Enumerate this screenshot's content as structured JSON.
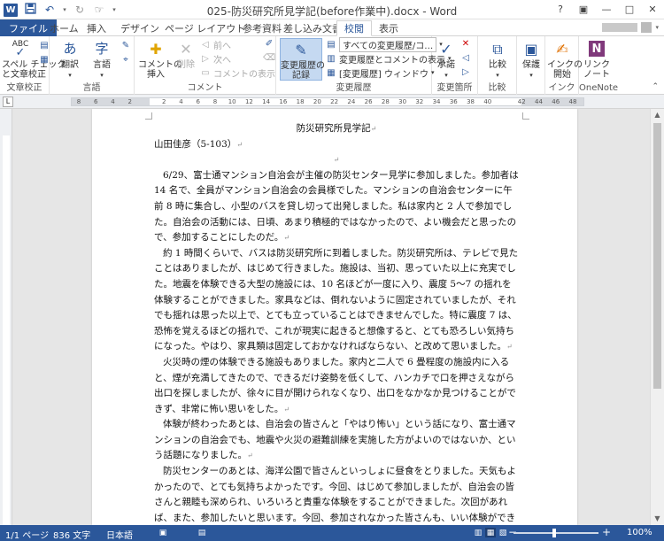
{
  "window": {
    "title": "025-防災研究所見学記(before作業中).docx - Word",
    "app_logo": "W",
    "qat_icons": [
      "save-icon",
      "undo-icon",
      "redo-icon",
      "touch-mode-icon"
    ],
    "controls": [
      "?",
      "▣",
      "—",
      "□",
      "✕"
    ]
  },
  "tabs": [
    {
      "label": "ファイル"
    },
    {
      "label": "ホーム"
    },
    {
      "label": "挿入"
    },
    {
      "label": "デザイン"
    },
    {
      "label": "ページ レイアウト"
    },
    {
      "label": "参考資料"
    },
    {
      "label": "差し込み文書"
    },
    {
      "label": "校閲"
    },
    {
      "label": "表示"
    }
  ],
  "active_tab": "校閲",
  "ribbon": {
    "proofing": {
      "group_label": "文章校正",
      "spell_label": "スペル チェック\nと文章校正",
      "spell_top": "ABC"
    },
    "language": {
      "group_label": "言語",
      "translate_label": "翻訳",
      "language_label": "言語"
    },
    "comments": {
      "group_label": "コメント",
      "new_comment": "コメントの\n挿入",
      "delete": "削除",
      "prev": "前へ",
      "next": "次へ",
      "show_comments": "コメントの表示"
    },
    "tracking": {
      "group_label": "変更履歴",
      "track_changes": "変更履歴の\n記録",
      "display_dropdown": "すべての変更履歴/コ…",
      "show_markup": "変更履歴とコメントの表示",
      "reviewing_pane": "[変更履歴] ウィンドウ"
    },
    "changes": {
      "group_label": "変更箇所",
      "accept": "承諾"
    },
    "compare": {
      "group_label": "比較",
      "compare": "比較"
    },
    "protect": {
      "group_label": "",
      "protect": "保護"
    },
    "ink": {
      "group_label": "インク",
      "start_inking": "インクの\n開始"
    },
    "onenote": {
      "group_label": "OneNote",
      "linked_notes": "リンク\nノート"
    }
  },
  "ruler": {
    "ticks": [
      "8",
      "6",
      "4",
      "2",
      "",
      "2",
      "4",
      "6",
      "8",
      "10",
      "12",
      "14",
      "16",
      "18",
      "20",
      "22",
      "24",
      "26",
      "28",
      "30",
      "32",
      "34",
      "36",
      "38",
      "40",
      "",
      "42",
      "44",
      "46",
      "48"
    ]
  },
  "document": {
    "title": "防災研究所見学記",
    "author": "山田佳彦（5-103）",
    "paragraph_mark": "↵",
    "paragraphs": [
      "6/29、富士通マンション自治会が主催の防災センター見学に参加しました。参加者は 14 名で、全員がマンション自治会の会員様でした。マンションの自治会センターに午前 8 時に集合し、小型のバスを貸し切って出発しました。私は家内と 2 人で参加でした。自治会の活動には、日頃、あまり積極的ではなかったので、よい機会だと思ったので、参加することにしたのだ。",
      "約 1 時間くらいで、バスは防災研究所に到着しました。防災研究所は、テレビで見たことはありましたが、はじめて行きました。施設は、当初、思っていた以上に充実でした。地震を体験できる大型の施設には、10 名ほどが一度に入り、震度 5～7 の揺れを体験することができました。家具などは、倒れないように固定されていましたが、それでも揺れは思った以上で、とても立っていることはできませんでした。特に震度 7 は、恐怖を覚えるほどの揺れで、これが現実に起きると想像すると、とても恐ろしい気持ちになった。やはり、家具類は固定しておかなければならない、と改めて思いました。",
      "火災時の煙の体験できる施設もありました。家内と二人で 6 畳程度の施設内に入ると、煙が充満してきたので、できるだけ姿勢を低くして、ハンカチで口を押さえながら出口を探しましたが、徐々に目が開けられなくなり、出口をなかなか見つけることができず、非常に怖い思いをした。",
      "体験が終わったあとは、自治会の皆さんと「やはり怖い」という話になり、富士通マンションの自治会でも、地震や火災の避難訓練を実施した方がよいのではないか、という話題になりました。",
      "防災センターのあとは、海洋公園で皆さんといっしょに昼食をとりました。天気もよかったので、とても気持ちよかったです。今回、はじめて参加しましたが、自治会の皆さんと親睦も深められ、いろいろと貴重な体験をすることができました。次回があれば、また、参加したいと思います。今回、参加されなかった皆さんも、いい体験ができますので、ぜひおす"
    ]
  },
  "status": {
    "page": "1/1 ページ",
    "words": "836 文字",
    "language": "日本語",
    "zoom": "100%",
    "zoom_minus": "−",
    "zoom_plus": "+"
  }
}
